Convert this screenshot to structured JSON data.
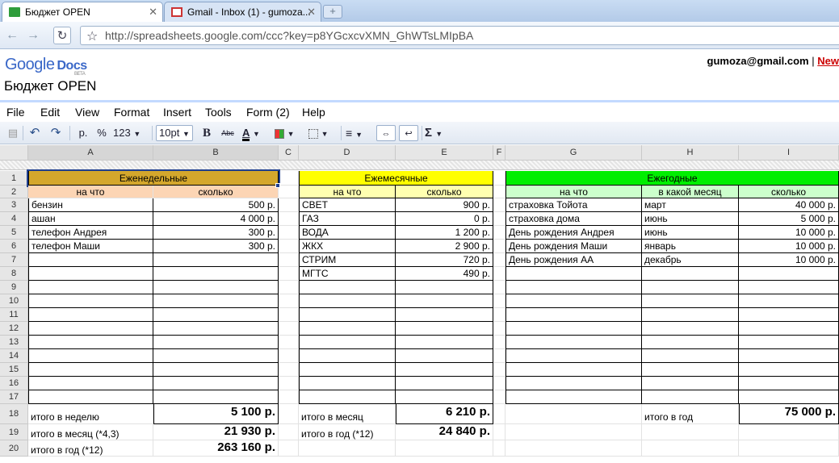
{
  "browser": {
    "tabs": [
      {
        "title": "Бюджет OPEN",
        "active": true
      },
      {
        "title": "Gmail - Inbox (1) - gumoza...",
        "active": false
      }
    ],
    "url": "http://spreadsheets.google.com/ccc?key=p8YGcxcvXMN_GhWTsLMIpBA"
  },
  "app": {
    "logo_google": "Google",
    "logo_docs": "Docs",
    "logo_beta": "BETA",
    "doc_title": "Бюджет OPEN",
    "user_email": "gumoza@gmail.com",
    "separator": "|",
    "new_link": "New"
  },
  "menu": [
    "File",
    "Edit",
    "View",
    "Format",
    "Insert",
    "Tools",
    "Form (2)",
    "Help"
  ],
  "toolbar": {
    "currency": "р.",
    "percent": "%",
    "number_format": "123",
    "font_size": "10pt",
    "bold": "B",
    "strike": "Abc",
    "text_color": "A",
    "sum": "Σ"
  },
  "sheet": {
    "columns": [
      "A",
      "B",
      "C",
      "D",
      "E",
      "F",
      "G",
      "H",
      "I"
    ],
    "rows": [
      "1",
      "2",
      "3",
      "4",
      "5",
      "6",
      "7",
      "8",
      "9",
      "10",
      "11",
      "12",
      "13",
      "14",
      "15",
      "16",
      "17",
      "18",
      "19",
      "20"
    ],
    "weekly": {
      "title": "Еженедельные",
      "col1": "на что",
      "col2": "сколько",
      "items": [
        {
          "name": "бензин",
          "amount": "500 р."
        },
        {
          "name": "ашан",
          "amount": "4 000 р."
        },
        {
          "name": "телефон Андрея",
          "amount": "300 р."
        },
        {
          "name": "телефон Маши",
          "amount": "300 р."
        }
      ],
      "total_week_label": "итого в неделю",
      "total_week": "5 100 р.",
      "total_month_label": "итого в месяц (*4,3)",
      "total_month": "21 930 р.",
      "total_year_label": "итого в год (*12)",
      "total_year": "263 160 р."
    },
    "monthly": {
      "title": "Ежемесячные",
      "col1": "на что",
      "col2": "сколько",
      "items": [
        {
          "name": "СВЕТ",
          "amount": "900 р."
        },
        {
          "name": "ГАЗ",
          "amount": "0 р."
        },
        {
          "name": "ВОДА",
          "amount": "1 200 р."
        },
        {
          "name": "ЖКХ",
          "amount": "2 900 р."
        },
        {
          "name": "СТРИМ",
          "amount": "720 р."
        },
        {
          "name": "МГТС",
          "amount": "490 р."
        }
      ],
      "total_month_label": "итого в месяц",
      "total_month": "6 210 р.",
      "total_year_label": "итого в год (*12)",
      "total_year": "24 840 р."
    },
    "yearly": {
      "title": "Ежегодные",
      "col1": "на что",
      "col2": "в какой месяц",
      "col3": "сколько",
      "items": [
        {
          "name": "страховка Тойота",
          "month": "март",
          "amount": "40 000 р."
        },
        {
          "name": "страховка дома",
          "month": "июнь",
          "amount": "5 000 р."
        },
        {
          "name": "День рождения Андрея",
          "month": "июнь",
          "amount": "10 000 р."
        },
        {
          "name": "День рождения Маши",
          "month": "январь",
          "amount": "10 000 р."
        },
        {
          "name": "День рождения АА",
          "month": "декабрь",
          "amount": "10 000 р."
        }
      ],
      "total_year_label": "итого в год",
      "total_year": "75 000 р."
    },
    "colors": {
      "weekly_header": "#d4a72c",
      "weekly_sub": "#fcd5b4",
      "monthly_header": "#ffff00",
      "monthly_sub": "#ffffb0",
      "yearly_header": "#00ee00",
      "yearly_sub": "#ccffcc"
    }
  }
}
